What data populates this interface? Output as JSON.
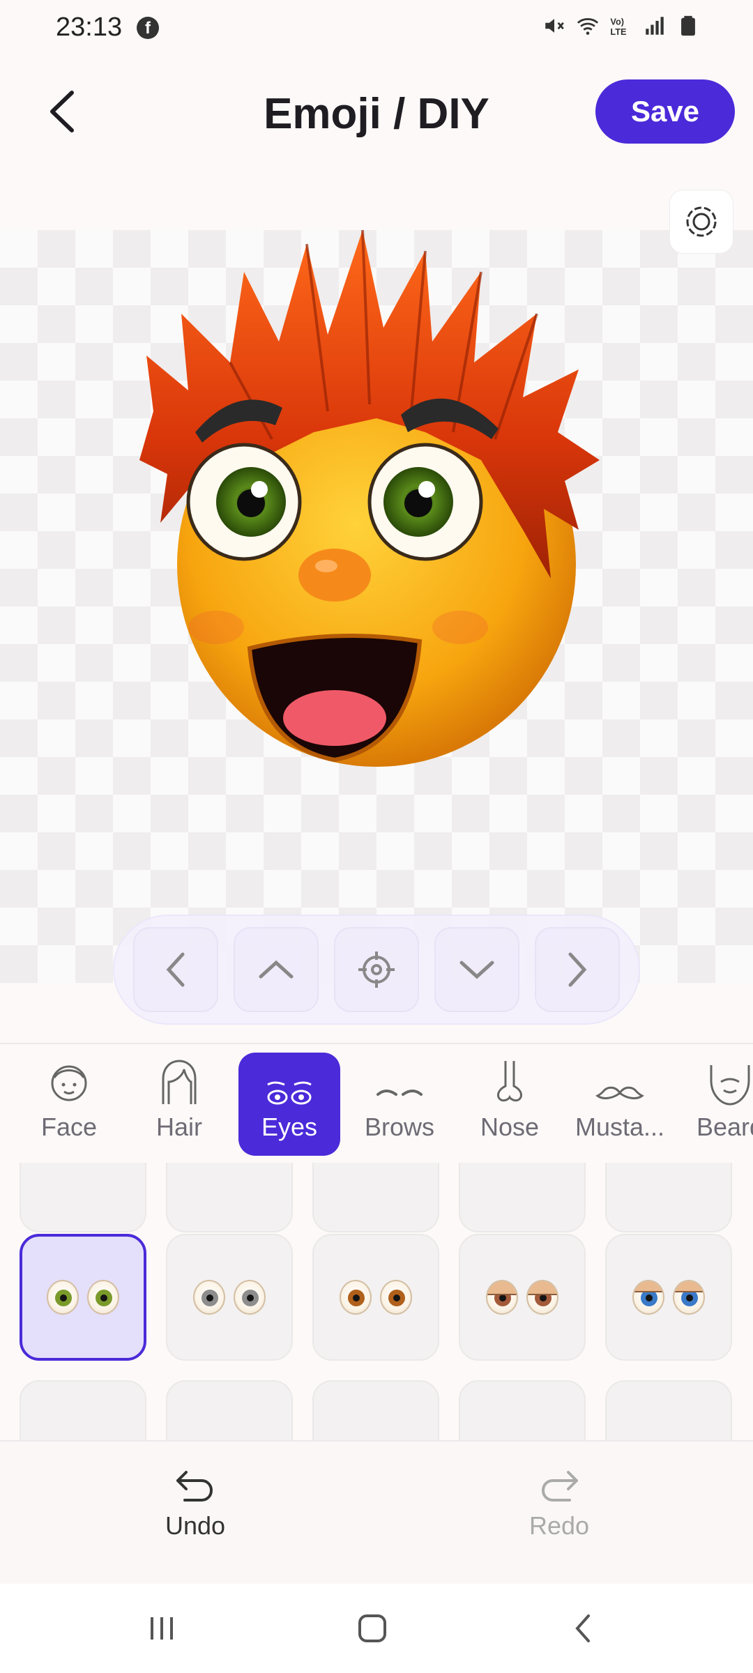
{
  "status_bar": {
    "time": "23:13",
    "notification_icon": "facebook-icon",
    "icons": [
      "mute-icon",
      "wifi-icon",
      "volte-icon",
      "signal-icon",
      "battery-icon"
    ]
  },
  "header": {
    "title": "Emoji / DIY",
    "save_label": "Save",
    "back_icon": "chevron-left-icon"
  },
  "canvas": {
    "reset_icon": "target-icon",
    "preview": "emoji-avatar-preview"
  },
  "position_controls": [
    "chevron-left-icon",
    "chevron-up-icon",
    "crosshair-icon",
    "chevron-down-icon",
    "chevron-right-icon"
  ],
  "tabs": [
    {
      "label": "Face",
      "icon": "face-icon",
      "active": false
    },
    {
      "label": "Hair",
      "icon": "hair-icon",
      "active": false
    },
    {
      "label": "Eyes",
      "icon": "eyes-icon",
      "active": true
    },
    {
      "label": "Brows",
      "icon": "brows-icon",
      "active": false
    },
    {
      "label": "Nose",
      "icon": "nose-icon",
      "active": false
    },
    {
      "label": "Musta...",
      "icon": "mustache-icon",
      "active": false
    },
    {
      "label": "Beard",
      "icon": "beard-icon",
      "active": false
    }
  ],
  "eye_options": {
    "selected_index": 0,
    "visible_row_colors": [
      "#7a9a2a",
      "#8d8d8d",
      "#b0601a",
      "#a35a3a",
      "#3a7ac8"
    ]
  },
  "actions": {
    "undo_label": "Undo",
    "redo_label": "Redo",
    "redo_enabled": false
  },
  "colors": {
    "accent": "#4b2ad9",
    "selected_bg": "#e4dffa"
  }
}
